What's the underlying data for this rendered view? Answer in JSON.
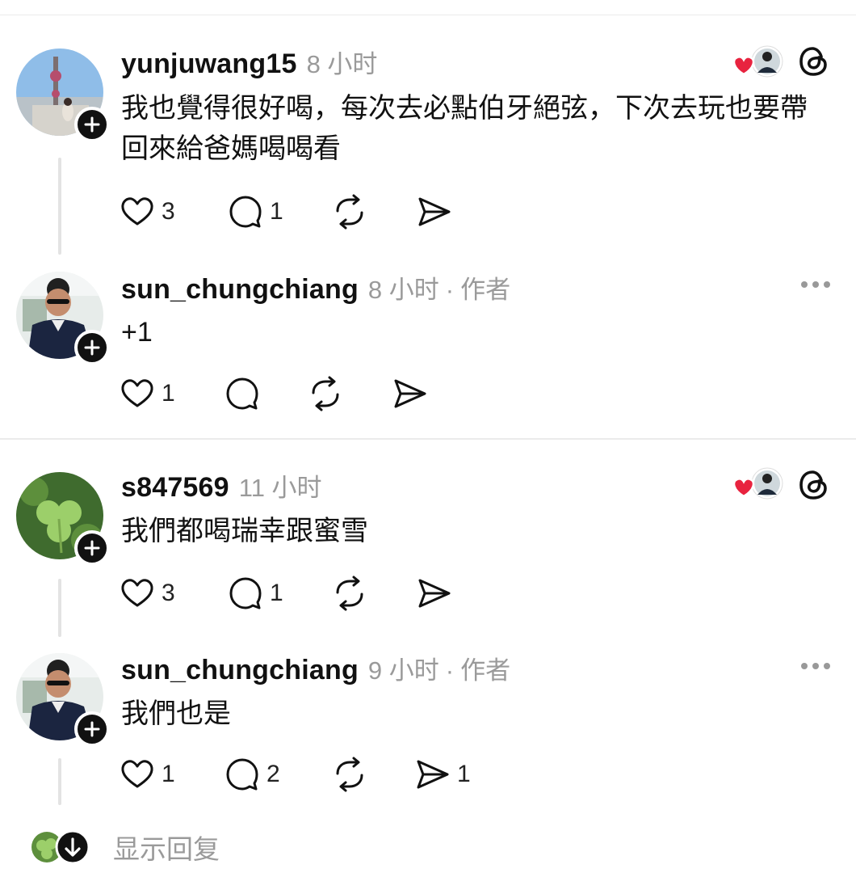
{
  "comments": [
    {
      "username": "yunjuwang15",
      "time": "8 小时",
      "author": "",
      "text": "我也覺得很好喝，每次去必點伯牙絕弦，下次去玩也要帶回來給爸媽喝喝看",
      "likes": "3",
      "replies": "1",
      "reposts": "",
      "shares": ""
    },
    {
      "username": "sun_chungchiang",
      "time": "8 小时",
      "author": "作者",
      "text": "+1",
      "likes": "1",
      "replies": "",
      "reposts": "",
      "shares": ""
    },
    {
      "username": "s847569",
      "time": "11 小时",
      "author": "",
      "text": "我們都喝瑞幸跟蜜雪",
      "likes": "3",
      "replies": "1",
      "reposts": "",
      "shares": ""
    },
    {
      "username": "sun_chungchiang",
      "time": "9 小时",
      "author": "作者",
      "text": "我們也是",
      "likes": "1",
      "replies": "2",
      "reposts": "",
      "shares": "1"
    }
  ],
  "dot_separator": "·",
  "show_replies_label": "显示回复",
  "colors": {
    "like_heart": "#e8233f",
    "muted_text": "#9a9a9a",
    "badge": "#111111"
  },
  "icons": [
    "heart-icon",
    "comment-bubble-icon",
    "repost-icon",
    "send-icon",
    "more-dots-icon",
    "threads-logo-icon",
    "plus-icon",
    "chevron-down-icon"
  ]
}
